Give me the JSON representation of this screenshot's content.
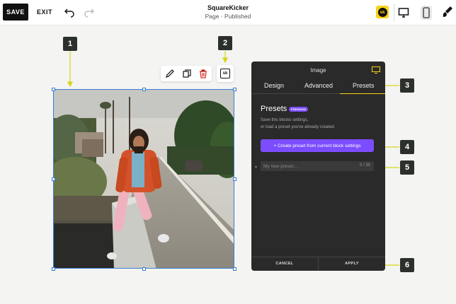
{
  "topbar": {
    "save_label": "SAVE",
    "exit_label": "EXIT",
    "site_title": "SquareKicker",
    "site_status": "Page · Published",
    "sk_badge": "sk"
  },
  "icons": {
    "undo": "undo-icon",
    "redo": "redo-icon",
    "desktop": "desktop-icon",
    "mobile": "mobile-icon",
    "brush": "brush-icon",
    "edit": "pencil-icon",
    "duplicate": "duplicate-icon",
    "delete": "trash-icon",
    "squarekicker": "squarekicker-icon"
  },
  "callouts": [
    "1",
    "2",
    "3",
    "4",
    "5",
    "6"
  ],
  "panel": {
    "title": "Image",
    "tabs": [
      {
        "label": "Design",
        "active": false
      },
      {
        "label": "Advanced",
        "active": false
      },
      {
        "label": "Presets",
        "active": true
      }
    ],
    "heading": "Presets",
    "badge": "PREMIUM",
    "description_line1": "Save this blocks settings,",
    "description_line2": "or load a preset you've already created.",
    "create_button": "+ Create preset from current block settings",
    "preset_input": {
      "placeholder": "My new preset...",
      "counter": "0 / 30"
    },
    "footer": {
      "cancel": "CANCEL",
      "apply": "APPLY"
    }
  },
  "colors": {
    "accent_purple": "#7c4dff",
    "highlight_yellow": "#f7d417",
    "callout_bg": "#2c302c",
    "selection_blue": "#3a7bd5"
  }
}
